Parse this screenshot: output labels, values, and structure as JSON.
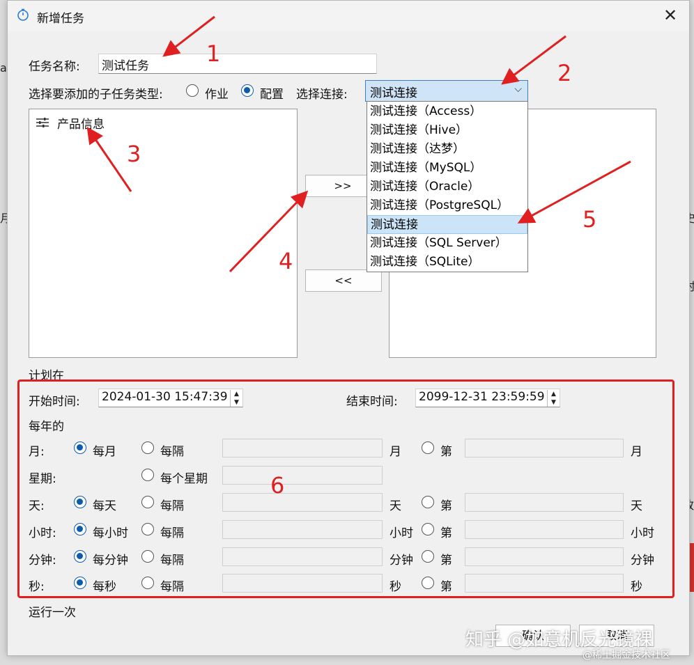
{
  "dialog": {
    "title": "新增任务",
    "close": "✕"
  },
  "task_name": {
    "label": "任务名称:",
    "value": "测试任务"
  },
  "subtask_type": {
    "label": "选择要添加的子任务类型:",
    "option_job": "作业",
    "option_config": "配置",
    "selected": "配置"
  },
  "connection": {
    "label": "选择连接:",
    "selected": "测试连接",
    "options": [
      "测试连接（Access）",
      "测试连接（Hive）",
      "测试连接（达梦）",
      "测试连接（MySQL）",
      "测试连接（Oracle）",
      "测试连接（PostgreSQL）",
      "测试连接",
      "测试连接（SQL Server）",
      "测试连接（SQLite）"
    ]
  },
  "left_list": {
    "items": [
      "产品信息"
    ]
  },
  "transfer": {
    "add": ">>",
    "remove": "<<"
  },
  "schedule": {
    "heading": "计划在",
    "start_label": "开始时间:",
    "start_value": "2024-01-30 15:47:39",
    "end_label": "结束时间:",
    "end_value": "2099-12-31 23:59:59",
    "yearly": "每年的",
    "rows": [
      {
        "label": "月:",
        "every": "每月",
        "interval": "每隔",
        "unit": "月",
        "nth": "第",
        "unit2": "月"
      },
      {
        "label": "星期:",
        "interval": "每个星期"
      },
      {
        "label": "天:",
        "every": "每天",
        "interval": "每隔",
        "unit": "天",
        "nth": "第",
        "unit2": "天"
      },
      {
        "label": "小时:",
        "every": "每小时",
        "interval": "每隔",
        "unit": "小时",
        "nth": "第",
        "unit2": "小时"
      },
      {
        "label": "分钟:",
        "every": "每分钟",
        "interval": "每隔",
        "unit": "分钟",
        "nth": "第",
        "unit2": "分钟"
      },
      {
        "label": "秒:",
        "every": "每秒",
        "interval": "每隔",
        "unit": "秒",
        "nth": "第",
        "unit2": "秒"
      }
    ],
    "run_once": "运行一次"
  },
  "footer": {
    "ok": "确认",
    "cancel": "取消"
  },
  "annotations": [
    "1",
    "2",
    "3",
    "4",
    "5",
    "6"
  ],
  "watermark": {
    "main": "知乎 @如意机反光镜裸",
    "sub": "@稀土掘金技术社区"
  },
  "colors": {
    "accent": "#0b5cad",
    "annotation": "#e02020",
    "selection": "#cce4f7"
  }
}
